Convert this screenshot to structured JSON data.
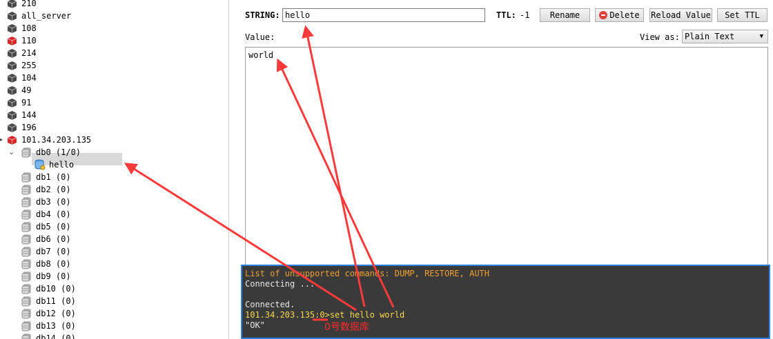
{
  "tree": {
    "items": [
      {
        "label": "210",
        "kind": "server"
      },
      {
        "label": "all_server",
        "kind": "server"
      },
      {
        "label": "108",
        "kind": "server"
      },
      {
        "label": "110",
        "kind": "server-red"
      },
      {
        "label": "214",
        "kind": "server"
      },
      {
        "label": "255",
        "kind": "server"
      },
      {
        "label": "104",
        "kind": "server"
      },
      {
        "label": "49",
        "kind": "server"
      },
      {
        "label": "91",
        "kind": "server"
      },
      {
        "label": "144",
        "kind": "server"
      },
      {
        "label": "196",
        "kind": "server"
      },
      {
        "label": "101.34.203.135",
        "kind": "server-red"
      },
      {
        "label": "db0  (1/0)",
        "kind": "db",
        "expanded": true
      },
      {
        "label": "hello",
        "kind": "key",
        "selected": true
      },
      {
        "label": "db1  (0)",
        "kind": "db"
      },
      {
        "label": "db2  (0)",
        "kind": "db"
      },
      {
        "label": "db3  (0)",
        "kind": "db"
      },
      {
        "label": "db4  (0)",
        "kind": "db"
      },
      {
        "label": "db5  (0)",
        "kind": "db"
      },
      {
        "label": "db6  (0)",
        "kind": "db"
      },
      {
        "label": "db7  (0)",
        "kind": "db"
      },
      {
        "label": "db8  (0)",
        "kind": "db"
      },
      {
        "label": "db9  (0)",
        "kind": "db"
      },
      {
        "label": "db10  (0)",
        "kind": "db"
      },
      {
        "label": "db11  (0)",
        "kind": "db"
      },
      {
        "label": "db12  (0)",
        "kind": "db"
      },
      {
        "label": "db13  (0)",
        "kind": "db"
      },
      {
        "label": "db14  (0)",
        "kind": "db"
      }
    ]
  },
  "detail": {
    "type_label": "STRING:",
    "key_value": "hello",
    "ttl_label": "TTL:",
    "ttl_value": "-1",
    "rename_label": "Rename",
    "delete_label": "Delete",
    "reload_label": "Reload Value",
    "setttl_label": "Set TTL",
    "value_label": "Value:",
    "viewas_label": "View as:",
    "viewas_selected": "Plain Text",
    "value_text": "world"
  },
  "console": {
    "lines": [
      {
        "text": "List of unsupported commands: DUMP, RESTORE, AUTH",
        "style": "orange"
      },
      {
        "text": "Connecting ...",
        "style": "normal"
      },
      {
        "text": "",
        "style": "normal"
      },
      {
        "text": "Connected.",
        "style": "normal"
      },
      {
        "text": "101.34.203.135:0>set hello world",
        "style": "yellow"
      },
      {
        "text": "\"OK\"",
        "style": "normal"
      }
    ]
  },
  "annotation": {
    "text": "0号数据库",
    "color": "#ff2a2a"
  },
  "colors": {
    "accent_border": "#2d7fe1",
    "console_bg": "#3a3a3a",
    "selection_bg": "#d9d9d9",
    "server_red": "#d62a2a"
  }
}
